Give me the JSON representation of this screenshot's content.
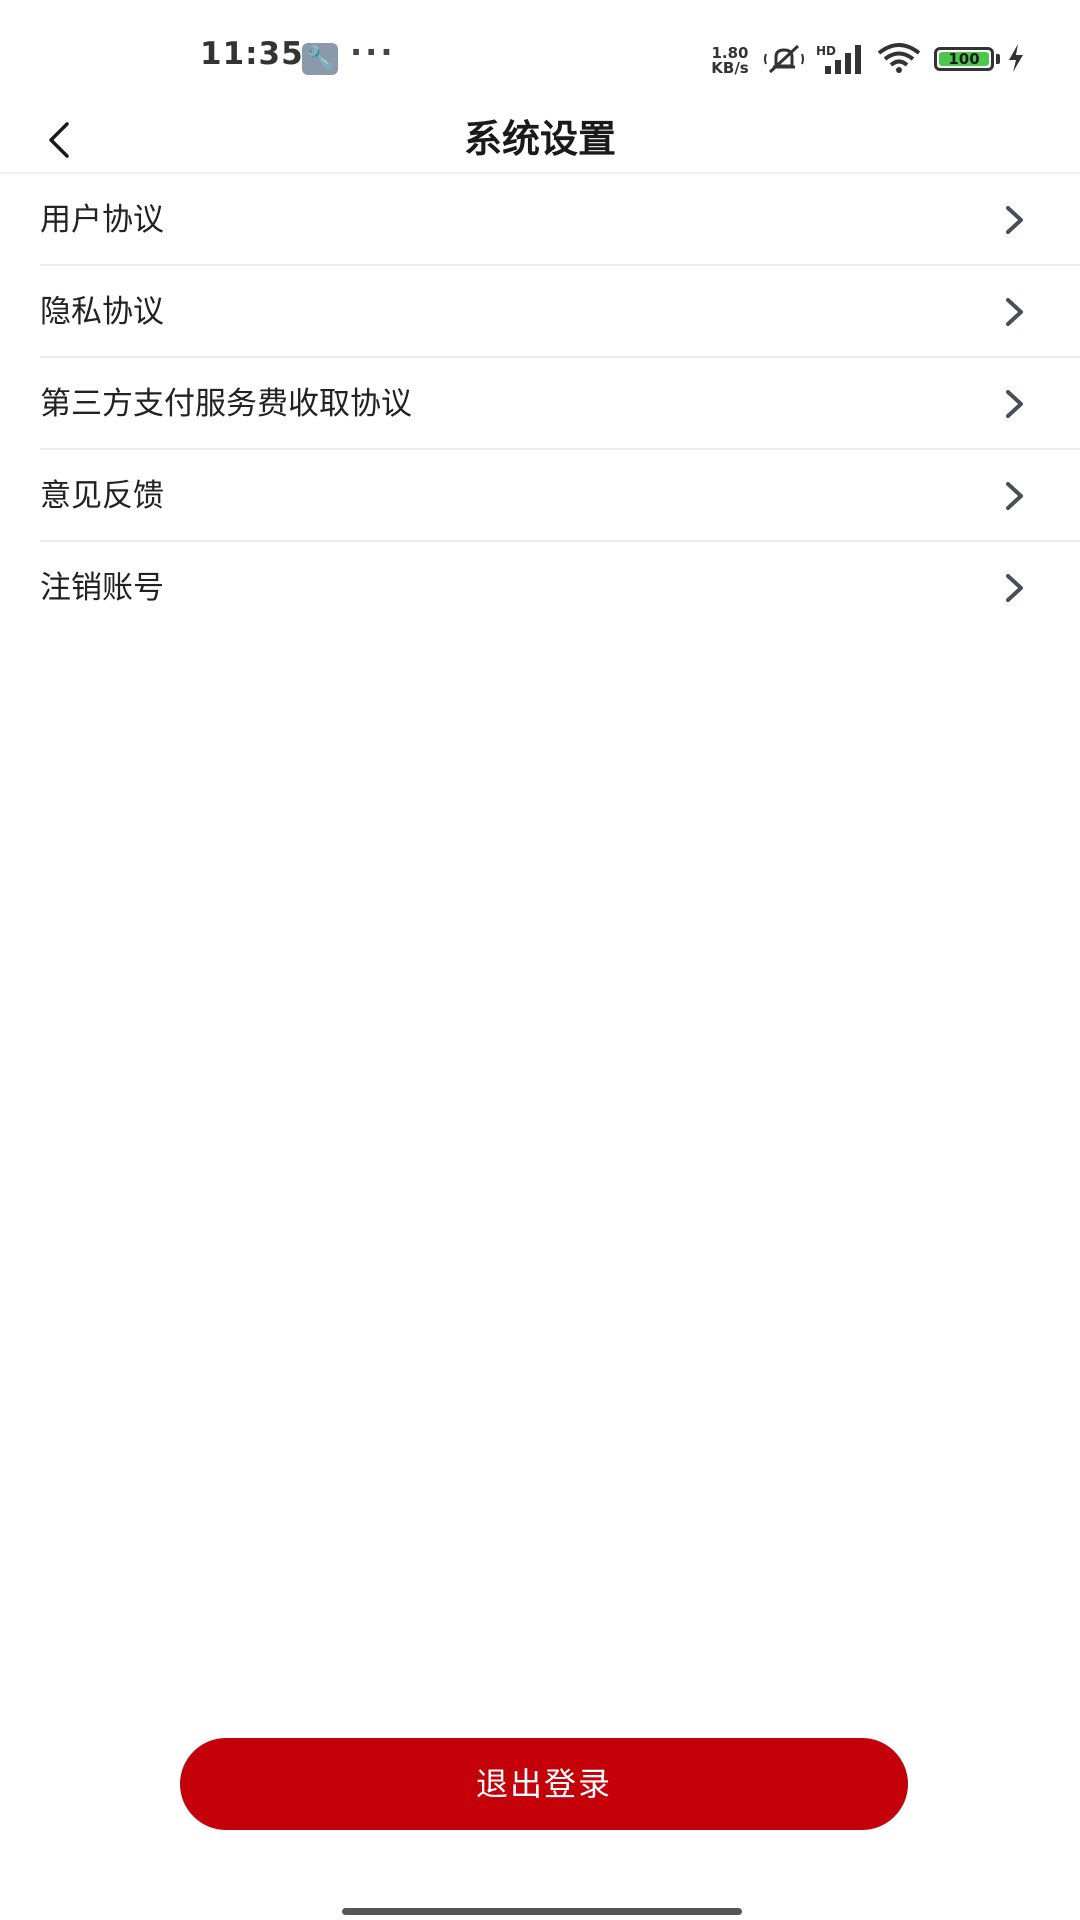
{
  "status_bar": {
    "time": "11:35",
    "app_icon": "wrench-icon",
    "more_dots": "···",
    "net_speed_value": "1.80",
    "net_speed_unit": "KB/s",
    "network_label": "HD",
    "battery_level": "100",
    "battery_fraction": 1.0,
    "battery_color": "#4cc64c"
  },
  "header": {
    "back_icon": "chevron-left-icon",
    "title": "系统设置"
  },
  "settings": {
    "items": [
      {
        "label": "用户协议"
      },
      {
        "label": "隐私协议"
      },
      {
        "label": "第三方支付服务费收取协议"
      },
      {
        "label": "意见反馈"
      },
      {
        "label": "注销账号"
      }
    ],
    "row_icon": "chevron-right-icon"
  },
  "logout": {
    "label": "退出登录",
    "color": "#c40009"
  }
}
